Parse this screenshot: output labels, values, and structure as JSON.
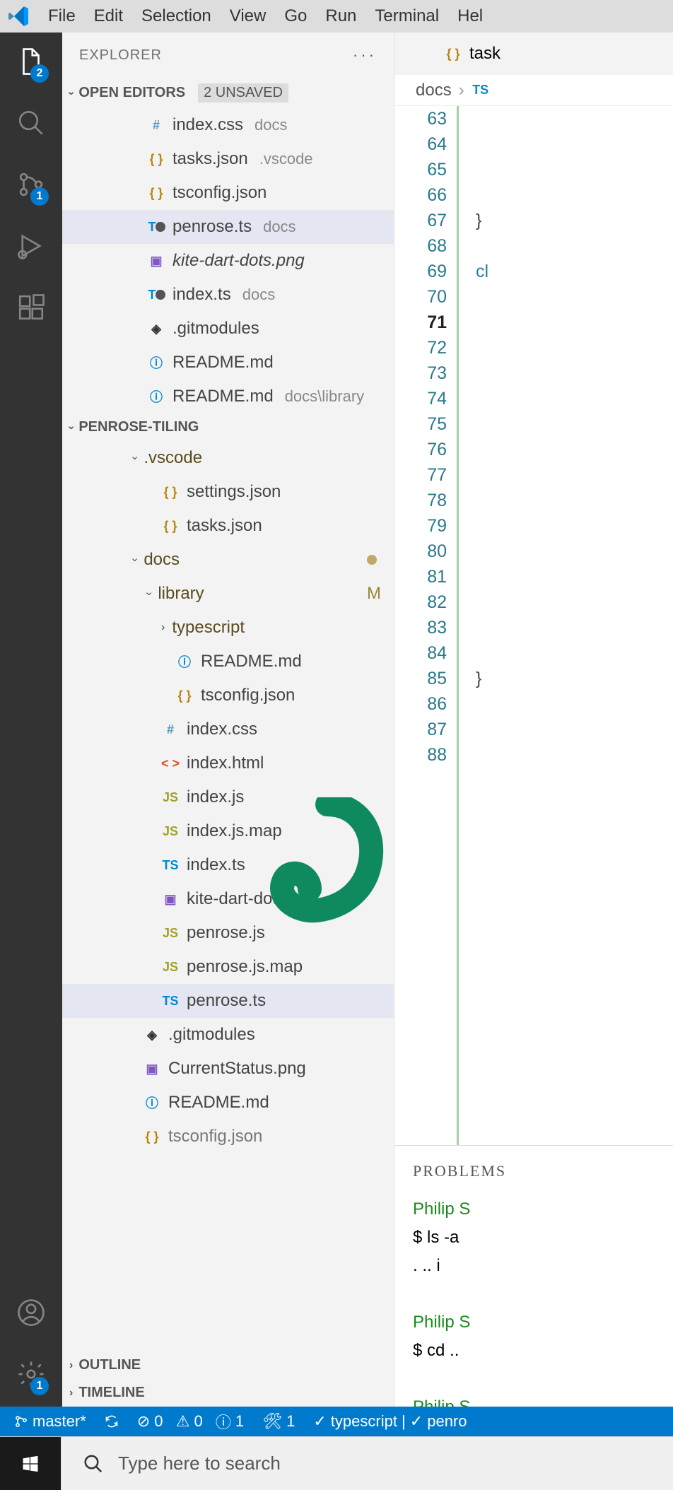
{
  "menubar": [
    "File",
    "Edit",
    "Selection",
    "View",
    "Go",
    "Run",
    "Terminal",
    "Hel"
  ],
  "activity_badges": {
    "explorer": "2",
    "scm": "1",
    "settings": "1"
  },
  "explorer": {
    "title": "EXPLORER",
    "open_editors": {
      "label": "OPEN EDITORS",
      "unsaved": "2 UNSAVED"
    },
    "editors": [
      {
        "icon": "css",
        "name": "index.css",
        "suffix": "docs"
      },
      {
        "icon": "json",
        "name": "tasks.json",
        "suffix": ".vscode"
      },
      {
        "icon": "json",
        "name": "tsconfig.json",
        "suffix": ""
      },
      {
        "icon": "ts",
        "name": "penrose.ts",
        "suffix": "docs",
        "dirty": true,
        "selected": true
      },
      {
        "icon": "img",
        "name": "kite-dart-dots.png",
        "suffix": "",
        "italic": true
      },
      {
        "icon": "ts",
        "name": "index.ts",
        "suffix": "docs",
        "dirty": true
      },
      {
        "icon": "git",
        "name": ".gitmodules",
        "suffix": ""
      },
      {
        "icon": "info",
        "name": "README.md",
        "suffix": ""
      },
      {
        "icon": "info",
        "name": "README.md",
        "suffix": "docs\\library"
      }
    ],
    "project": "PENROSE-TILING",
    "tree": [
      {
        "t": "folder",
        "d": 0,
        "name": ".vscode",
        "open": true
      },
      {
        "t": "file",
        "d": 1,
        "icon": "json",
        "name": "settings.json"
      },
      {
        "t": "file",
        "d": 1,
        "icon": "json",
        "name": "tasks.json"
      },
      {
        "t": "folder",
        "d": 0,
        "name": "docs",
        "open": true,
        "badge": "dot"
      },
      {
        "t": "folder",
        "d": 1,
        "name": "library",
        "open": true,
        "badge": "M"
      },
      {
        "t": "folder",
        "d": 2,
        "name": "typescript",
        "open": false
      },
      {
        "t": "file",
        "d": 2,
        "icon": "info",
        "name": "README.md"
      },
      {
        "t": "file",
        "d": 2,
        "icon": "json",
        "name": "tsconfig.json"
      },
      {
        "t": "file",
        "d": 1,
        "icon": "css",
        "name": "index.css"
      },
      {
        "t": "file",
        "d": 1,
        "icon": "html",
        "name": "index.html"
      },
      {
        "t": "file",
        "d": 1,
        "icon": "js",
        "name": "index.js"
      },
      {
        "t": "file",
        "d": 1,
        "icon": "js",
        "name": "index.js.map"
      },
      {
        "t": "file",
        "d": 1,
        "icon": "ts",
        "name": "index.ts"
      },
      {
        "t": "file",
        "d": 1,
        "icon": "img",
        "name": "kite-dart-dots.png"
      },
      {
        "t": "file",
        "d": 1,
        "icon": "js",
        "name": "penrose.js"
      },
      {
        "t": "file",
        "d": 1,
        "icon": "js",
        "name": "penrose.js.map"
      },
      {
        "t": "file",
        "d": 1,
        "icon": "ts",
        "name": "penrose.ts",
        "selected": true
      },
      {
        "t": "file",
        "d": 0,
        "icon": "git",
        "name": ".gitmodules"
      },
      {
        "t": "file",
        "d": 0,
        "icon": "img",
        "name": "CurrentStatus.png"
      },
      {
        "t": "file",
        "d": 0,
        "icon": "info",
        "name": "README.md"
      },
      {
        "t": "file",
        "d": 0,
        "icon": "json",
        "name": "tsconfig.json",
        "cut": true
      }
    ],
    "outline": "OUTLINE",
    "timeline": "TIMELINE"
  },
  "editor": {
    "tab": {
      "icon": "json",
      "name": "task"
    },
    "breadcrumb": {
      "a": "docs",
      "b": "TS"
    },
    "first_line": 63,
    "last_line": 88,
    "current_line": 71,
    "snippets": {
      "l67": "}",
      "l69": "cl",
      "l85": "}"
    }
  },
  "terminal": {
    "title": "PROBLEMS",
    "lines": [
      {
        "cls": "term-green",
        "text": "Philip S"
      },
      {
        "cls": "",
        "text": "$ ls -a"
      },
      {
        "cls": "",
        "text": ".  ..  i"
      },
      {
        "cls": "",
        "text": ""
      },
      {
        "cls": "term-green",
        "text": "Philip S"
      },
      {
        "cls": "",
        "text": "$ cd .."
      },
      {
        "cls": "",
        "text": ""
      },
      {
        "cls": "term-green",
        "text": "Philip S"
      },
      {
        "cls": "",
        "text": "$ ▯"
      }
    ]
  },
  "statusbar": {
    "branch": "master*",
    "errors": "0",
    "warnings": "0",
    "info": "1",
    "tools": "1",
    "lang": "typescript",
    "task": "penro"
  },
  "taskbar": {
    "search_placeholder": "Type here to search"
  }
}
